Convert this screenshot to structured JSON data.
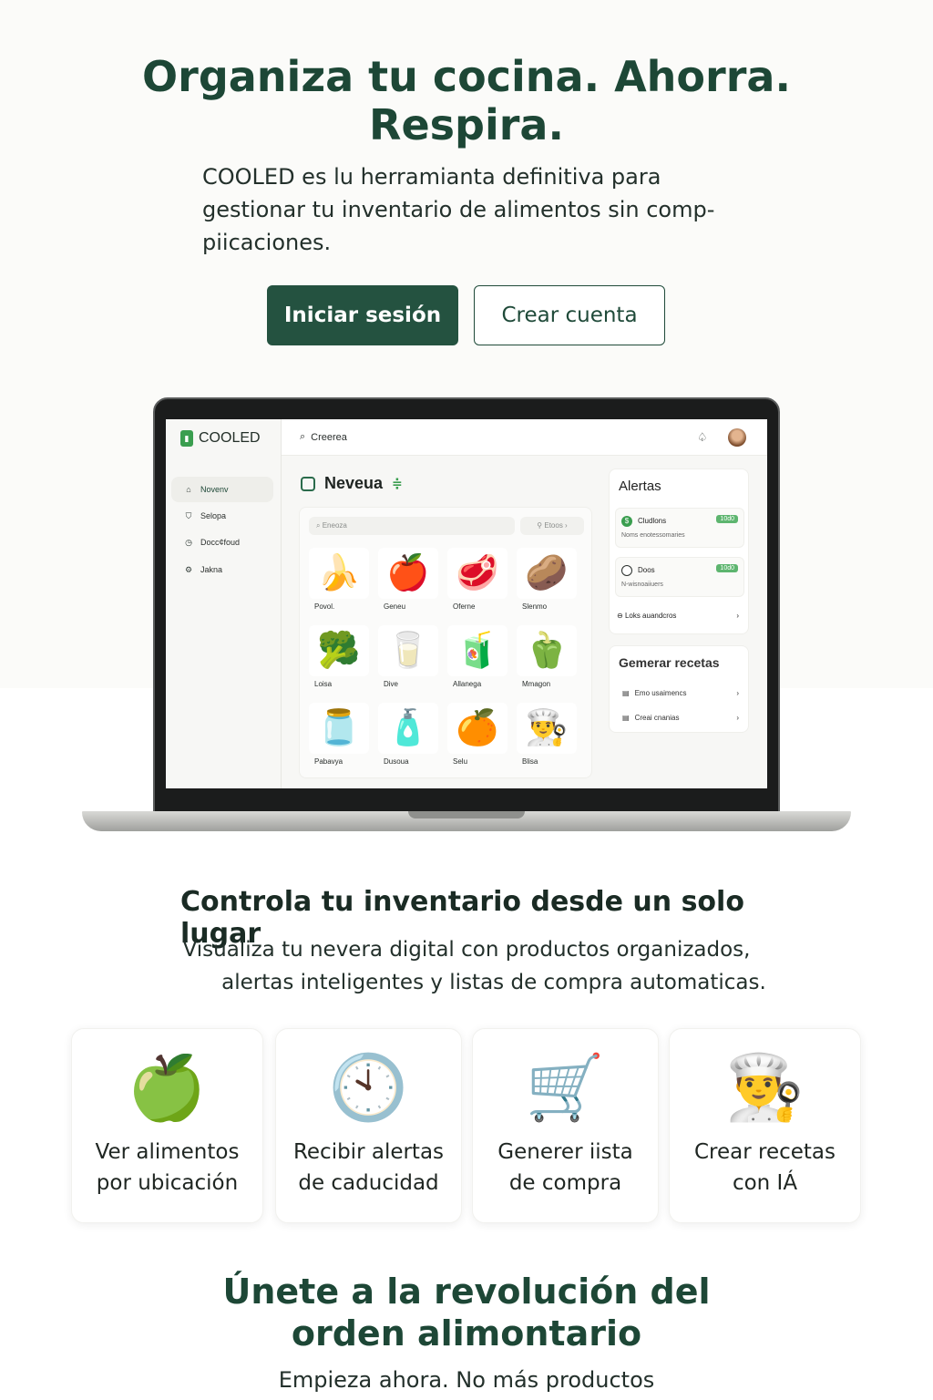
{
  "hero": {
    "title_line1": "Organiza tu cocina. Ahorra.",
    "title_line2": "Respira.",
    "subtitle": "COOLED es lu herramianta definitiva para gestionar tu inventario de alimentos sin comp-piicaciones.",
    "login_label": "Iniciar sesión",
    "signup_label": "Crear cuenta"
  },
  "app": {
    "brand": "COOLED",
    "search": "Creerea",
    "sidebar": [
      {
        "label": "Novenv",
        "icon": "home-icon",
        "active": true
      },
      {
        "label": "Selopa",
        "icon": "shield-icon",
        "active": false
      },
      {
        "label": "Docc¢foud",
        "icon": "clock-icon",
        "active": false
      },
      {
        "label": "Jakna",
        "icon": "gear-icon",
        "active": false
      }
    ],
    "fridge_title": "Neveua",
    "inner_search": "Eneoza",
    "inner_filter": "Etoos",
    "items": [
      {
        "label": "Povol.",
        "emoji": "🍌"
      },
      {
        "label": "Geneu",
        "emoji": "🍎"
      },
      {
        "label": "Oferne",
        "emoji": "🥩"
      },
      {
        "label": "Slenmo",
        "emoji": "🥔"
      },
      {
        "label": "Loisa",
        "emoji": "🥦"
      },
      {
        "label": "Dive",
        "emoji": "🥛"
      },
      {
        "label": "Allanega",
        "emoji": "🧃"
      },
      {
        "label": "Mmagon",
        "emoji": "🫑"
      },
      {
        "label": "Pabavya",
        "emoji": "🫙"
      },
      {
        "label": "Dusoua",
        "emoji": "🧴"
      },
      {
        "label": "Selu",
        "emoji": "🍊"
      },
      {
        "label": "Blisa",
        "emoji": "👨‍🍳"
      }
    ],
    "alerts": {
      "title": "Alertas",
      "items": [
        {
          "name": "Cludlons",
          "sub": "Noms enotessomaries",
          "badge": "10d0"
        },
        {
          "name": "Doos",
          "sub": "N-wisnoaiiuers",
          "badge": "10d0"
        }
      ],
      "link": "Loks auandcros"
    },
    "recipes": {
      "title": "Gemerar recetas",
      "items": [
        {
          "label": "Emo usaimencs"
        },
        {
          "label": "Creai cnanias"
        }
      ]
    }
  },
  "section2": {
    "title": "Controla tu inventario desde un solo lugar",
    "subtitle_line1": "Visualiza tu nevera digital con productos organizados,",
    "subtitle_line2": "alertas inteligentes y listas de compra automaticas."
  },
  "features": [
    {
      "line1": "Ver alimentos",
      "line2": "por ubicación",
      "emoji": "🍏",
      "icon": "apple-icon"
    },
    {
      "line1": "Recibir alertas",
      "line2": "de caducidad",
      "emoji": "🕙",
      "icon": "clock-icon"
    },
    {
      "line1": "Generer iista",
      "line2": "de compra",
      "emoji": "🛒",
      "icon": "cart-icon"
    },
    {
      "line1": "Crear recetas",
      "line2": "con IÁ",
      "emoji": "👨‍🍳",
      "icon": "chef-icon"
    }
  ],
  "cta": {
    "title_line1": "Únete a la revolución del",
    "title_line2": "orden alimontario",
    "subtitle": "Empieza ahora. No más productos"
  }
}
